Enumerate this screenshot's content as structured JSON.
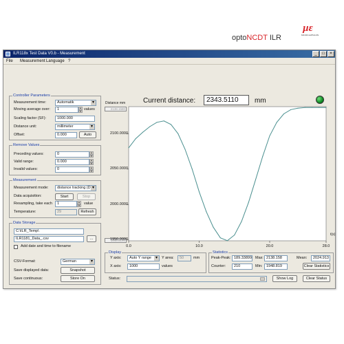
{
  "window": {
    "title": "ILR118x Test Data  V0.b - Measurement",
    "menu": [
      "File",
      "Measurement",
      "Language",
      "?"
    ]
  },
  "brand": {
    "title_prefix": "opto",
    "title_highlight": "NCDT",
    "title_suffix": " ILR",
    "logo_text": "MICRO-EPSILON"
  },
  "current": {
    "label": "Current distance:",
    "value": "2343.5110",
    "unit": "mm"
  },
  "controller": {
    "title": "Controller Parameters",
    "measurement_time_label": "Measurement time:",
    "measurement_time_value": "Automatik",
    "moving_average_label": "Moving average over:",
    "moving_average_value": "1",
    "moving_average_unit": "values",
    "scaling_label": "Scaling factor (SF):",
    "scaling_value": "1000.000",
    "distance_unit_label": "Distance unit:",
    "distance_unit_value": "millimeter",
    "offset_label": "Offset:",
    "offset_value": "0.000",
    "auto_button": "Auto"
  },
  "remove": {
    "title": "Remove Values",
    "preceding_label": "Preceding values:",
    "preceding_value": "0",
    "valid_label": "Valid range:",
    "valid_value": "0.000",
    "invalid_label": "Invalid values:",
    "invalid_value": "0"
  },
  "measurement": {
    "title": "Measurement",
    "mode_label": "Measurement mode:",
    "mode_value": "distance tracking (DT",
    "acquisition_label": "Data acquisition:",
    "start_button": "Start",
    "stop_button": "Stop",
    "resampling_label": "Resampling, take each",
    "resampling_value": "1",
    "resampling_unit": "value",
    "temperature_label": "Temperature:",
    "temperature_value": "29",
    "refresh_button": "Refresh"
  },
  "storage": {
    "title": "Data Storage",
    "path_value": "C:\\ILR_Temp\\",
    "file_value": "ILR1181_Data_.csv",
    "browse_button": "...",
    "add_datetime_label": "Add date and time to filename",
    "csv_format_label": "CSV-Format:",
    "csv_format_value": "German",
    "save_displayed_label": "Save displayed data:",
    "snapshot_button": "Snapshot",
    "save_continuous_label": "Save continuous:",
    "store_on_button": "Store On"
  },
  "display": {
    "title": "Display",
    "y_axis_label": "Y axis:",
    "y_axis_value": "Auto Y range",
    "y_area_label": "Y area:",
    "y_area_value": "50",
    "y_area_unit": "mm",
    "x_axis_label": "X axis:",
    "x_axis_value": "1000",
    "x_axis_unit": "values"
  },
  "statistics": {
    "title": "Statistics",
    "peak_label": "Peak-Peak:",
    "peak_value": "189.33899",
    "max_label": "Max:",
    "max_value": "2138.158",
    "mean_label": "Mean:",
    "mean_value": "2024.913",
    "counter_label": "Counter:",
    "counter_value": "210",
    "min_label": "Min:",
    "min_value": "1948.819",
    "clear_stats_button": "Clear Statistics"
  },
  "statusbar": {
    "status_label": "Status:",
    "show_log_button": "Show Log",
    "clear_status_button": "Clear Status"
  },
  "colors": {
    "line": "#4a8f8f",
    "title_blue": "#1a3da8",
    "brand_red": "#d8242a"
  },
  "chart_data": {
    "type": "line",
    "ylabel": "Distance   mm",
    "xlabel": "t(s)",
    "ylim": [
      1948.819,
      2138.158
    ],
    "xlim": [
      0,
      28
    ],
    "y_range_top_label": "2138.1580",
    "y_range_bottom_label": "1948.8190",
    "yticks": [
      2100,
      2050,
      2000,
      1950
    ],
    "ytick_labels": [
      "2100.0000",
      "2050.0000",
      "2000.0000",
      "1950.0000"
    ],
    "xticks": [
      0,
      10,
      20,
      28
    ],
    "xtick_labels": [
      "0.0",
      "10.0",
      "20.0",
      "28.0"
    ],
    "series": [
      {
        "values_x": [
          0,
          1,
          2,
          3,
          4,
          5,
          6,
          7,
          8,
          9,
          10,
          11,
          12,
          13,
          14,
          15,
          16,
          17,
          18,
          19,
          20,
          21,
          22,
          23,
          24,
          25,
          26,
          27,
          28
        ],
        "values_y": [
          2080,
          2093,
          2102,
          2110,
          2116,
          2118,
          2113,
          2100,
          2078,
          2050,
          2018,
          1990,
          1968,
          1953,
          1949,
          1957,
          1976,
          2003,
          2035,
          2068,
          2097,
          2116,
          2128,
          2134,
          2136,
          2137,
          2137,
          2137,
          2137
        ]
      }
    ]
  }
}
